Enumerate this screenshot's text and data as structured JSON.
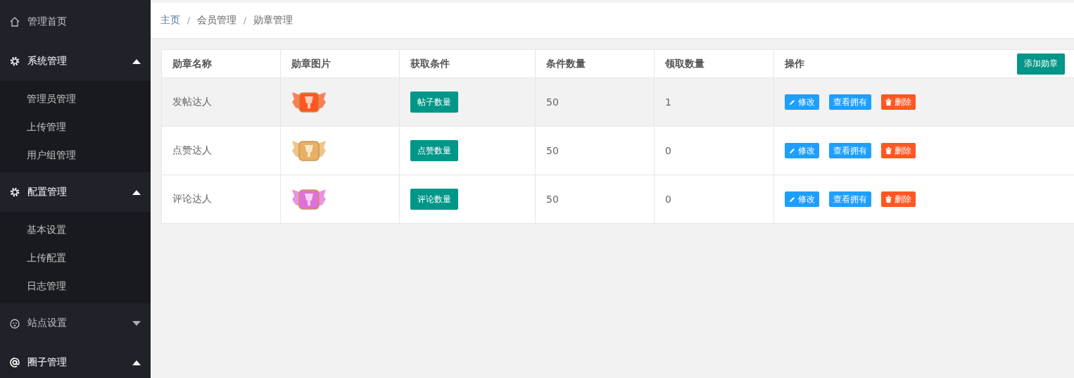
{
  "sidebar": {
    "items": [
      {
        "label": "管理首页",
        "kind": "home"
      },
      {
        "label": "系统管理",
        "kind": "gear",
        "expanded": true,
        "children": [
          {
            "label": "管理员管理"
          },
          {
            "label": "上传管理"
          },
          {
            "label": "用户组管理"
          }
        ]
      },
      {
        "label": "配置管理",
        "kind": "gear",
        "expanded": true,
        "children": [
          {
            "label": "基本设置"
          },
          {
            "label": "上传配置"
          },
          {
            "label": "日志管理"
          }
        ]
      },
      {
        "label": "站点设置",
        "kind": "face",
        "expanded": false
      },
      {
        "label": "圈子管理",
        "kind": "at",
        "expanded": true
      }
    ]
  },
  "breadcrumb": {
    "separator": "/",
    "items": [
      "主页",
      "会员管理",
      "勋章管理"
    ]
  },
  "table": {
    "columns": [
      "勋章名称",
      "勋章图片",
      "获取条件",
      "条件数量",
      "领取数量",
      "操作"
    ],
    "add_button": "添加勋章",
    "rows": [
      {
        "name": "发帖达人",
        "color": "#ff5722",
        "condition": "帖子数量",
        "condition_count": "50",
        "claimed": "1",
        "hovered": true,
        "actions": {
          "edit": "修改",
          "view": "查看拥有",
          "delete": "删除"
        }
      },
      {
        "name": "点赞达人",
        "color": "#e8b060",
        "condition": "点赞数量",
        "condition_count": "50",
        "claimed": "0",
        "hovered": false,
        "actions": {
          "edit": "修改",
          "view": "查看拥有",
          "delete": "删除"
        }
      },
      {
        "name": "评论达人",
        "color": "#e070d8",
        "condition": "评论数量",
        "condition_count": "50",
        "claimed": "0",
        "hovered": false,
        "actions": {
          "edit": "修改",
          "view": "查看拥有",
          "delete": "删除"
        }
      }
    ]
  }
}
